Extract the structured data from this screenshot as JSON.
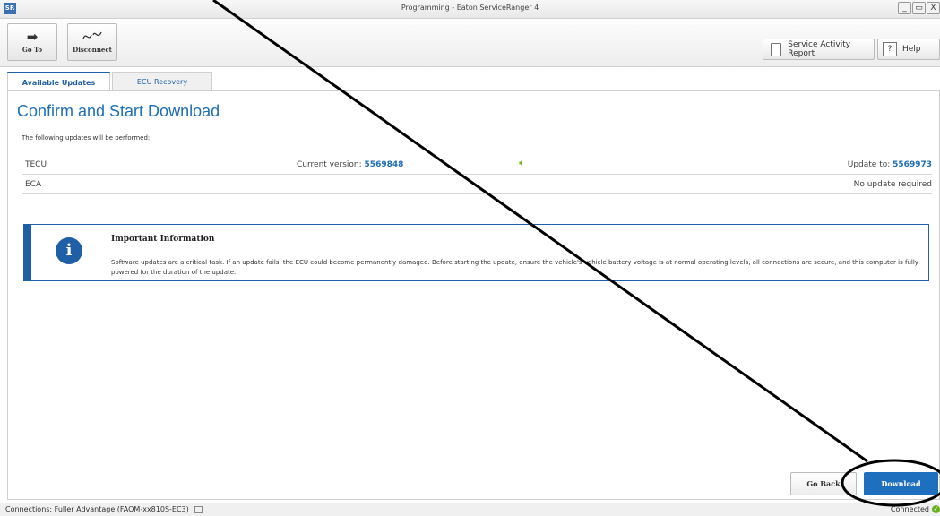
{
  "window": {
    "app_icon": "SR",
    "title": "Programming - Eaton ServiceRanger 4",
    "minimize": "_",
    "maximize": "▭",
    "close": "X"
  },
  "toolbar": {
    "goto_label": "Go To",
    "disconnect_label": "Disconnect",
    "service_report_label": "Service Activity Report",
    "help_label": "Help",
    "help_icon": "?"
  },
  "tabs": [
    {
      "label": "Available Updates",
      "active": true
    },
    {
      "label": "ECU Recovery",
      "active": false
    }
  ],
  "main": {
    "title": "Confirm and Start Download",
    "intro": "The following updates will be performed:",
    "updates": [
      {
        "ecu": "TECU",
        "current_label": "Current version:",
        "current_value": "5569848",
        "update_label": "Update to:",
        "update_value": "5569973"
      },
      {
        "ecu": "ECA",
        "status": "No update required"
      }
    ],
    "info": {
      "icon": "i",
      "heading": "Important Information",
      "body": "Software updates are a critical task.  If an update fails, the ECU could become permanently damaged.  Before starting the update, ensure the vehicle's vehicle battery voltage is at normal operating levels, all connections are secure, and this computer is fully powered for the duration of the update."
    },
    "go_back_label": "Go Back",
    "download_label": "Download"
  },
  "status": {
    "connections": "Connections: Fuller Advantage (FAOM-xx810S-EC3)",
    "connected": "Connected",
    "connected_icon": "✓"
  },
  "colors": {
    "accent": "#1f6fbf",
    "arrow": "#7ab51d",
    "connected": "#6ab023"
  },
  "icons": {
    "goto": "arrow-right-icon",
    "disconnect": "disconnect-icon",
    "report": "document-icon",
    "help": "help-icon",
    "info": "info-icon",
    "arrow": "arrow-right-icon",
    "connected": "check-circle-icon"
  }
}
